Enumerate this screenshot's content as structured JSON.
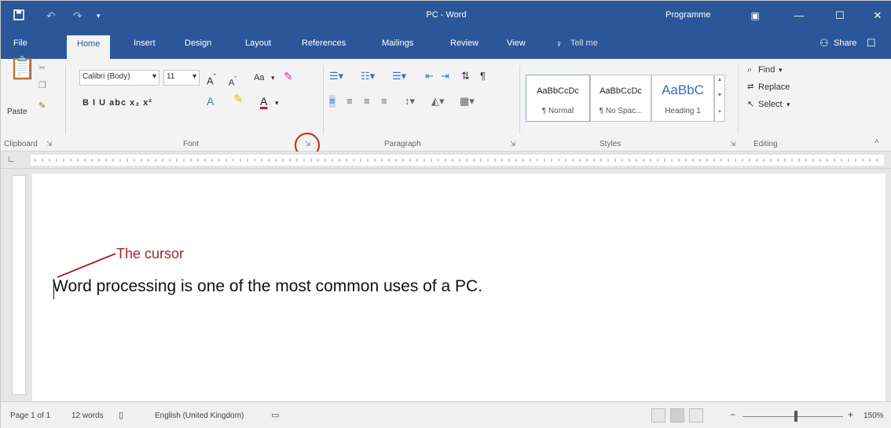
{
  "titlebar": {
    "save_icon": "floppy-disk-icon",
    "title": "PC - Word",
    "programme": "Programme",
    "minimize": "—",
    "maximize": "☐",
    "close": "✕",
    "color": "#2b579a"
  },
  "tabs": [
    "File",
    "Home",
    "Insert",
    "Design",
    "Layout",
    "References",
    "Mailings",
    "Review",
    "View",
    "Tell me"
  ],
  "share": "Share",
  "ribbon": {
    "clipboard": {
      "paste": "Paste",
      "label": "Clipboard"
    },
    "font": {
      "name": "Calibri (Body)",
      "size": "11",
      "label": "Font",
      "change_case": "Aa",
      "format_row": "B  I  U  abc  x₂  x²"
    },
    "paragraph": {
      "label": "Paragraph"
    },
    "styles": {
      "label": "Styles",
      "items": [
        {
          "preview": "AaBbCcDc",
          "name": "¶ Normal"
        },
        {
          "preview": "AaBbCcDc",
          "name": "¶ No Spac..."
        },
        {
          "preview": "AaBbC",
          "name": "Heading 1"
        }
      ]
    },
    "editing": {
      "find": "Find",
      "replace": "Replace",
      "select": "Select",
      "label": "Editing"
    }
  },
  "document": {
    "text": "Word processing is one of the most common uses of a PC.",
    "callout_label": "The cursor",
    "callout_color": "#a3272d",
    "highlight_circle_color": "#c0392b"
  },
  "statusbar": {
    "page": "Page 1 of 1",
    "words": "12 words",
    "language": "English (United Kingdom)",
    "zoom": "150%",
    "zoom_minus": "−",
    "zoom_plus": "+"
  }
}
